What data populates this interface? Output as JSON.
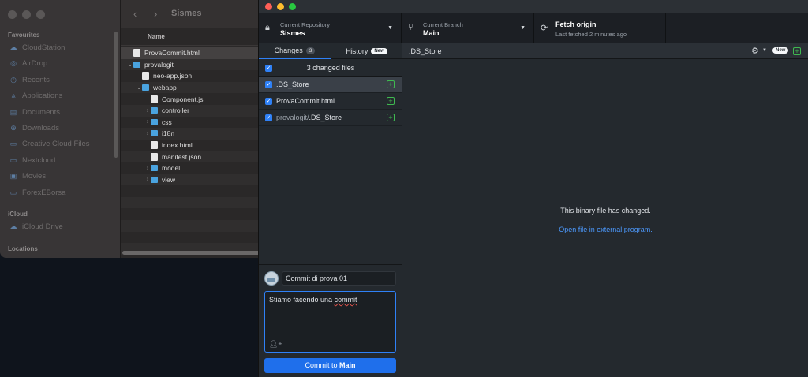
{
  "finder": {
    "title": "Sismes",
    "column_name": "Name",
    "sidebar": {
      "favourites_label": "Favourites",
      "favourites": [
        {
          "label": "CloudStation",
          "icon": "cloud-icon"
        },
        {
          "label": "AirDrop",
          "icon": "airdrop-icon"
        },
        {
          "label": "Recents",
          "icon": "clock-icon"
        },
        {
          "label": "Applications",
          "icon": "applications-icon"
        },
        {
          "label": "Documents",
          "icon": "document-icon"
        },
        {
          "label": "Downloads",
          "icon": "download-icon"
        },
        {
          "label": "Creative Cloud Files",
          "icon": "folder-icon"
        },
        {
          "label": "Nextcloud",
          "icon": "folder-icon"
        },
        {
          "label": "Movies",
          "icon": "movies-icon"
        },
        {
          "label": "ForexEBorsa",
          "icon": "folder-icon"
        }
      ],
      "icloud_label": "iCloud",
      "icloud": [
        {
          "label": "iCloud Drive",
          "icon": "cloud-icon"
        }
      ],
      "locations_label": "Locations"
    },
    "files": [
      {
        "name": "ProvaCommit.html",
        "type": "file",
        "indent": 0,
        "chevron": ""
      },
      {
        "name": "provalogit",
        "type": "folder",
        "indent": 0,
        "chevron": "⌄"
      },
      {
        "name": "neo-app.json",
        "type": "file",
        "indent": 1,
        "chevron": ""
      },
      {
        "name": "webapp",
        "type": "folder",
        "indent": 1,
        "chevron": "⌄"
      },
      {
        "name": "Component.js",
        "type": "js",
        "indent": 2,
        "chevron": ""
      },
      {
        "name": "controller",
        "type": "folder",
        "indent": 2,
        "chevron": "›"
      },
      {
        "name": "css",
        "type": "folder",
        "indent": 2,
        "chevron": "›"
      },
      {
        "name": "i18n",
        "type": "folder",
        "indent": 2,
        "chevron": "›"
      },
      {
        "name": "index.html",
        "type": "file",
        "indent": 2,
        "chevron": ""
      },
      {
        "name": "manifest.json",
        "type": "file",
        "indent": 2,
        "chevron": ""
      },
      {
        "name": "model",
        "type": "folder",
        "indent": 2,
        "chevron": "›"
      },
      {
        "name": "view",
        "type": "folder",
        "indent": 2,
        "chevron": "›"
      }
    ]
  },
  "github": {
    "repo": {
      "small": "Current Repository",
      "big": "Sismes"
    },
    "branch": {
      "small": "Current Branch",
      "big": "Main"
    },
    "fetch": {
      "big": "Fetch origin",
      "small": "Last fetched 2 minutes ago"
    },
    "tabs": {
      "changes_label": "Changes",
      "changes_count": "3",
      "history_label": "History",
      "history_badge": "New"
    },
    "changed_files_label": "3 changed files",
    "files": [
      {
        "dir": "",
        "name": ".DS_Store"
      },
      {
        "dir": "",
        "name": "ProvaCommit.html"
      },
      {
        "dir": "provalogit/",
        "name": ".DS_Store"
      }
    ],
    "commit": {
      "summary": "Commit di prova 01",
      "description_before": "Stiamo facendo una ",
      "description_typo": "commit",
      "button_prefix": "Commit to ",
      "button_branch": "Main"
    },
    "diff": {
      "filename": ".DS_Store",
      "new_badge": "New",
      "binary_message": "This binary file has changed.",
      "open_link": "Open file in external program."
    }
  }
}
